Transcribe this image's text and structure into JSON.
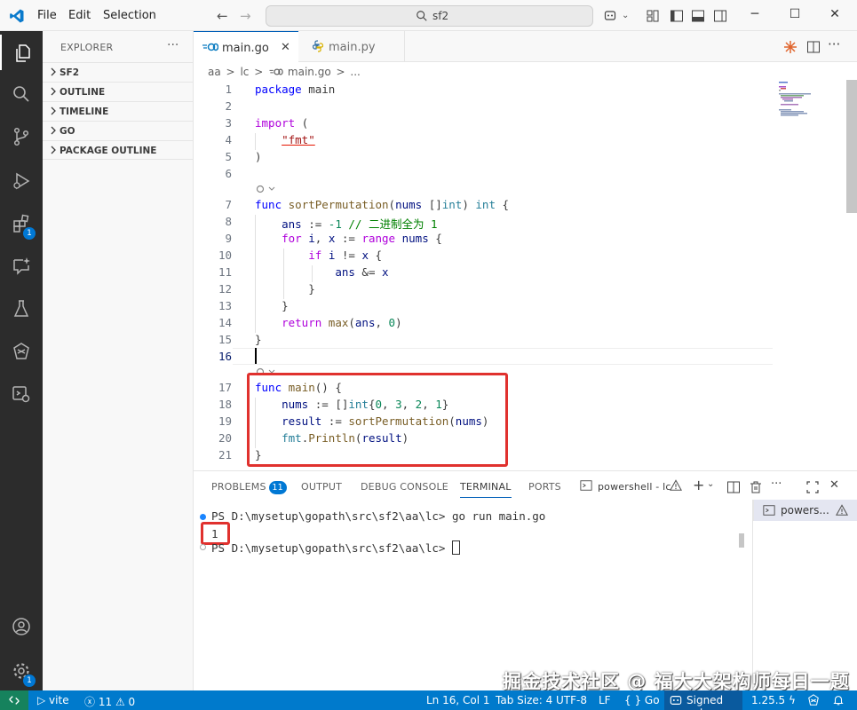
{
  "titlebar": {
    "menu": [
      "File",
      "Edit",
      "Selection"
    ],
    "search_text": "sf2"
  },
  "sidebar": {
    "title": "EXPLORER",
    "more": "···",
    "sections": [
      "SF2",
      "OUTLINE",
      "TIMELINE",
      "GO",
      "PACKAGE OUTLINE"
    ]
  },
  "activity": {
    "extensions_badge": "1",
    "manage_badge": "1"
  },
  "tabs": [
    {
      "label": "main.go",
      "active": true,
      "close": "✕"
    },
    {
      "label": "main.py",
      "active": false
    }
  ],
  "breadcrumb": [
    "aa",
    ">",
    "lc",
    ">",
    "main.go",
    ">",
    "..."
  ],
  "editor": {
    "line_numbers": [
      "1",
      "2",
      "3",
      "4",
      "5",
      "6",
      "7",
      "8",
      "9",
      "10",
      "11",
      "12",
      "13",
      "14",
      "15",
      "16",
      "17",
      "18",
      "19",
      "20",
      "21"
    ],
    "current_line": "16"
  },
  "panel": {
    "tabs": [
      "PROBLEMS",
      "OUTPUT",
      "DEBUG CONSOLE",
      "TERMINAL",
      "PORTS"
    ],
    "problems_count": "11",
    "terminal_name": "powershell - lc",
    "terminal_list_item": "powers...",
    "term_line1_prompt": "PS D:\\mysetup\\gopath\\src\\sf2\\aa\\lc> ",
    "term_line1_cmd": "go run main.go",
    "term_output": "1",
    "term_line3_prompt": "PS D:\\mysetup\\gopath\\src\\sf2\\aa\\lc> "
  },
  "statusbar": {
    "vite": "vite",
    "errors": "11",
    "warnings": "0",
    "position": "Ln 16, Col 1",
    "tab_size": "Tab Size: 4",
    "encoding": "UTF-8",
    "eol": "LF",
    "language": "Go",
    "signed": "Signed out",
    "go_version": "1.25.5"
  },
  "watermark": "掘金技术社区 @ 福大大架构师每日一题",
  "colors": {
    "accent": "#007acc",
    "activity_bg": "#2c2c2c",
    "highlight_box": "#e0312e"
  }
}
